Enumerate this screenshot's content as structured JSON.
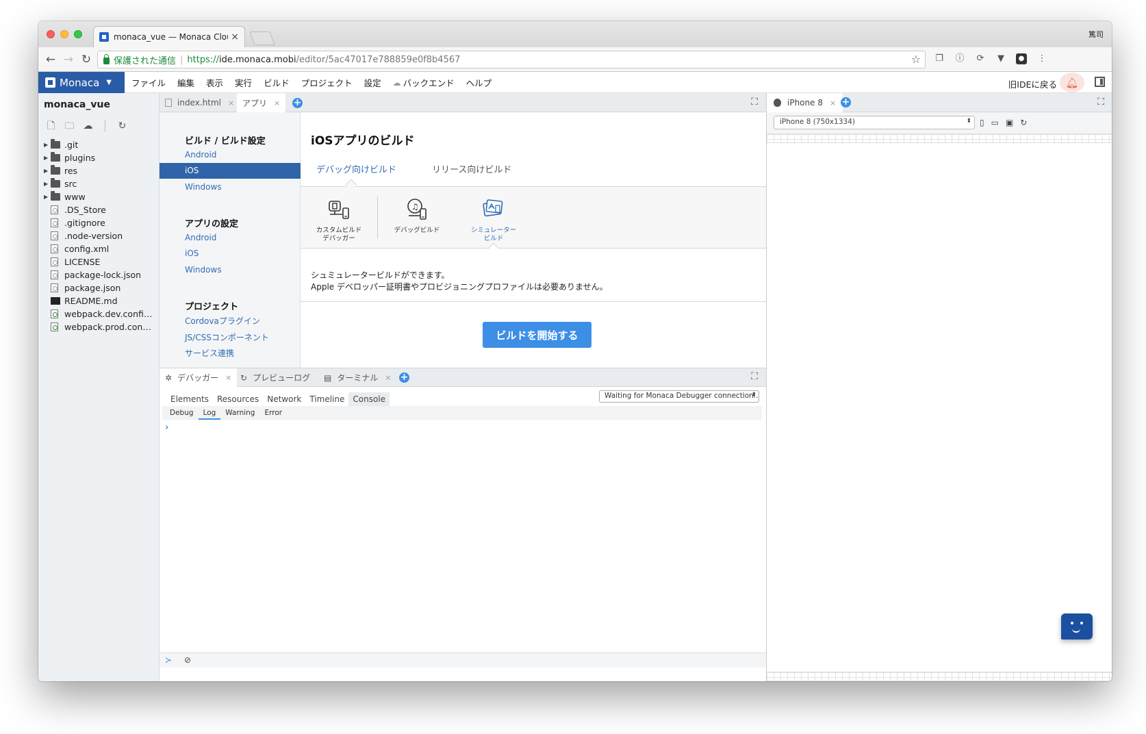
{
  "browser": {
    "tab_title": "monaca_vue — Monaca Cloud",
    "tab_close": "×",
    "user": "篤司",
    "secure_label": "保護された通信",
    "url_scheme": "https://",
    "url_host": "ide.monaca.mobi",
    "url_path": "/editor/5ac47017e788859e0f8b4567"
  },
  "menubar": {
    "brand": "Monaca",
    "items": [
      "ファイル",
      "編集",
      "表示",
      "実行",
      "ビルド",
      "プロジェクト",
      "設定",
      "バックエンド",
      "ヘルプ"
    ],
    "old_ide": "旧IDEに戻る"
  },
  "filetree": {
    "project_name": "monaca_vue",
    "items": [
      {
        "name": ".git",
        "type": "folder"
      },
      {
        "name": "plugins",
        "type": "folder"
      },
      {
        "name": "res",
        "type": "folder"
      },
      {
        "name": "src",
        "type": "folder"
      },
      {
        "name": "www",
        "type": "folder"
      },
      {
        "name": ".DS_Store",
        "type": "file"
      },
      {
        "name": ".gitignore",
        "type": "file"
      },
      {
        "name": ".node-version",
        "type": "file"
      },
      {
        "name": "config.xml",
        "type": "file"
      },
      {
        "name": "LICENSE",
        "type": "file"
      },
      {
        "name": "package-lock.json",
        "type": "file"
      },
      {
        "name": "package.json",
        "type": "file"
      },
      {
        "name": "README.md",
        "type": "md"
      },
      {
        "name": "webpack.dev.confi…",
        "type": "js"
      },
      {
        "name": "webpack.prod.con…",
        "type": "js"
      }
    ]
  },
  "editor": {
    "tabs": [
      {
        "label": "index.html",
        "active": false
      },
      {
        "label": "アプリ",
        "active": true
      }
    ],
    "tab_close": "×"
  },
  "build_nav": {
    "sections": [
      {
        "title": "ビルド / ビルド設定",
        "links": [
          "Android",
          "iOS",
          "Windows"
        ]
      },
      {
        "title": "アプリの設定",
        "links": [
          "Android",
          "iOS",
          "Windows"
        ]
      },
      {
        "title": "プロジェクト",
        "links": [
          "Cordovaプラグイン",
          "JS/CSSコンポーネント",
          "サービス連携"
        ]
      }
    ]
  },
  "build": {
    "title": "iOSアプリのビルド",
    "tabs": [
      "デバッグ向けビルド",
      "リリース向けビルド"
    ],
    "types": [
      {
        "label": "カスタムビルド\nデバッガー",
        "icon": "custom-debugger-icon"
      },
      {
        "label": "デバッグビルド",
        "icon": "debug-build-icon"
      },
      {
        "label": "シミュレーター\nビルド",
        "icon": "simulator-build-icon"
      }
    ],
    "desc_line1": "シュミュレータービルドができます。",
    "desc_line2": "Apple デベロッパー証明書やプロビジョニングプロファイルは必要ありません。",
    "start_button": "ビルドを開始する"
  },
  "bottom": {
    "tabs": [
      {
        "label": "デバッガー",
        "icon": "bug-icon"
      },
      {
        "label": "プレビューログ",
        "icon": "refresh-icon"
      },
      {
        "label": "ターミナル",
        "icon": "terminal-icon"
      }
    ],
    "tab_close": "×",
    "dev_tabs": [
      "Elements",
      "Resources",
      "Network",
      "Timeline",
      "Console"
    ],
    "debugger_status": "Waiting for Monaca Debugger connection...",
    "levels": [
      "Debug",
      "Log",
      "Warning",
      "Error"
    ],
    "prompt": "›"
  },
  "preview": {
    "tab_label": "iPhone 8",
    "tab_close": "×",
    "device": "iPhone 8 (750x1334)"
  },
  "colors": {
    "brand": "#2a5ba6",
    "accent": "#3d8ee5",
    "link": "#2f6db3",
    "secure": "#1d8a3a"
  }
}
